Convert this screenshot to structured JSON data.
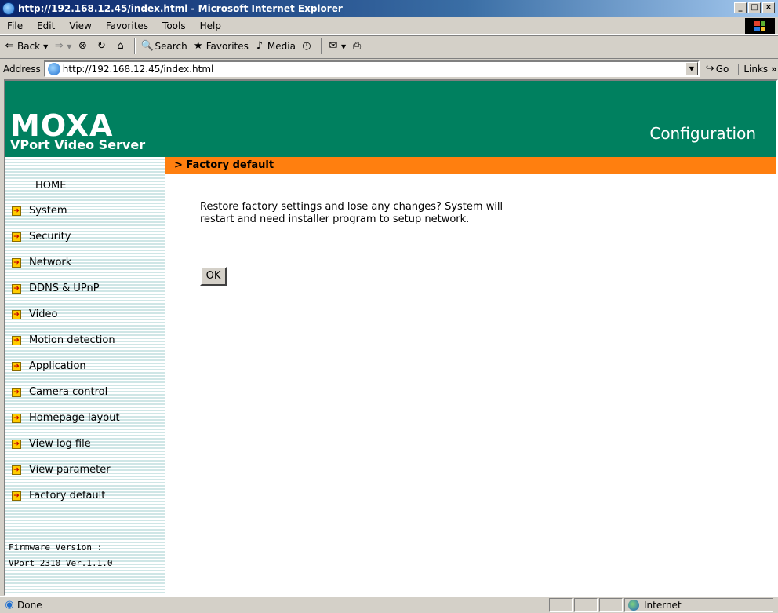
{
  "window": {
    "title": "http://192.168.12.45/index.html - Microsoft Internet Explorer"
  },
  "menu": [
    "File",
    "Edit",
    "View",
    "Favorites",
    "Tools",
    "Help"
  ],
  "toolbar": {
    "back": "Back",
    "search": "Search",
    "favorites": "Favorites",
    "media": "Media"
  },
  "address": {
    "label": "Address",
    "url": "http://192.168.12.45/index.html",
    "go": "Go",
    "links": "Links"
  },
  "header": {
    "logo": "MOXA",
    "product": "VPort Video Server",
    "section": "Configuration"
  },
  "sidebar": {
    "home": "HOME",
    "items": [
      "System",
      "Security",
      "Network",
      "DDNS & UPnP",
      "Video",
      "Motion detection",
      "Application",
      "Camera control",
      "Homepage layout",
      "View log file",
      "View parameter",
      "Factory default"
    ],
    "firmware_label": "Firmware Version :",
    "firmware_value": "VPort 2310 Ver.1.1.0"
  },
  "main": {
    "title": "> Factory default",
    "message": "Restore factory settings and lose any changes? System will restart and need installer program to setup network.",
    "ok_label": "OK"
  },
  "status": {
    "text": "Done",
    "zone": "Internet"
  }
}
